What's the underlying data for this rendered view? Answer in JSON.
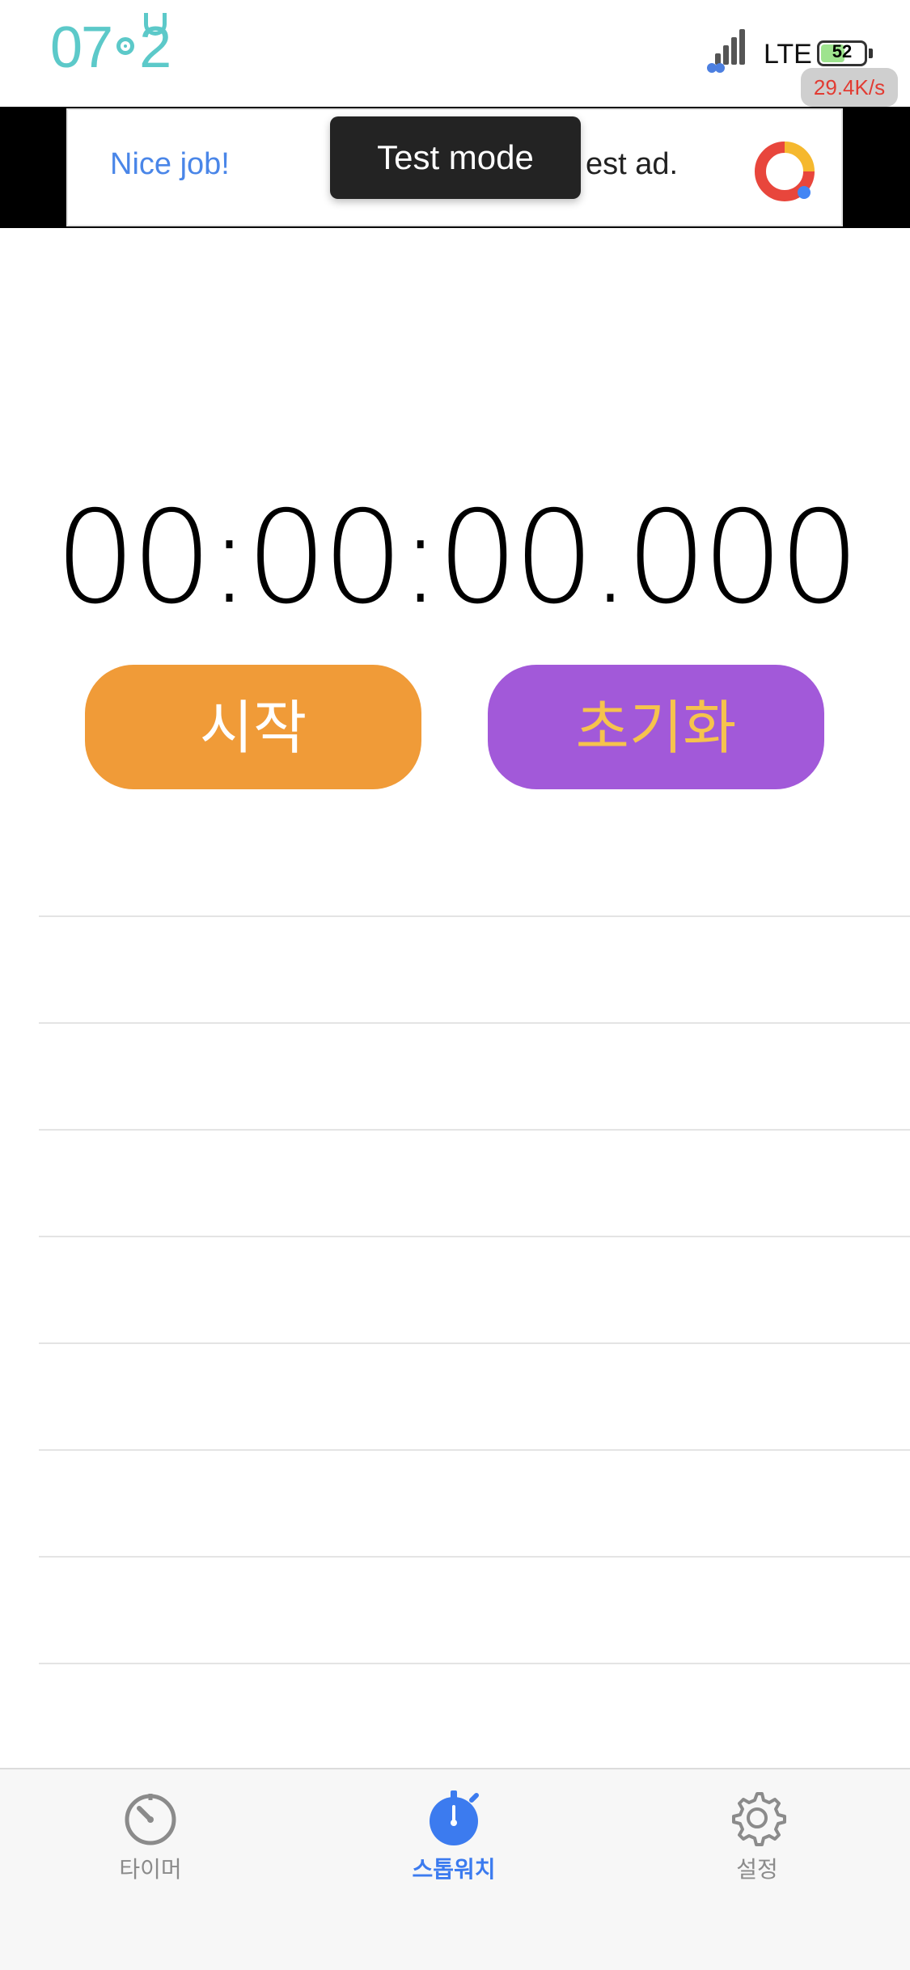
{
  "status_bar": {
    "time": "07:2",
    "network": "LTE",
    "battery": "52",
    "battery_level": 0.52,
    "speed": "29.4K/s"
  },
  "ad": {
    "nice": "Nice job!",
    "text": "est ad.",
    "toast": "Test mode"
  },
  "stopwatch": {
    "display": "00:00:00.000",
    "start_label": "시작",
    "reset_label": "초기화"
  },
  "colors": {
    "start": "#f09b38",
    "reset": "#a259d9",
    "reset_text": "#f6c34c",
    "active_tab": "#3c7bef",
    "clock": "#5cc9c9"
  },
  "tabs": [
    {
      "label": "타이머",
      "icon": "timer-icon"
    },
    {
      "label": "스톱워치",
      "icon": "stopwatch-icon",
      "active": true
    },
    {
      "label": "설정",
      "icon": "gear-icon"
    }
  ]
}
